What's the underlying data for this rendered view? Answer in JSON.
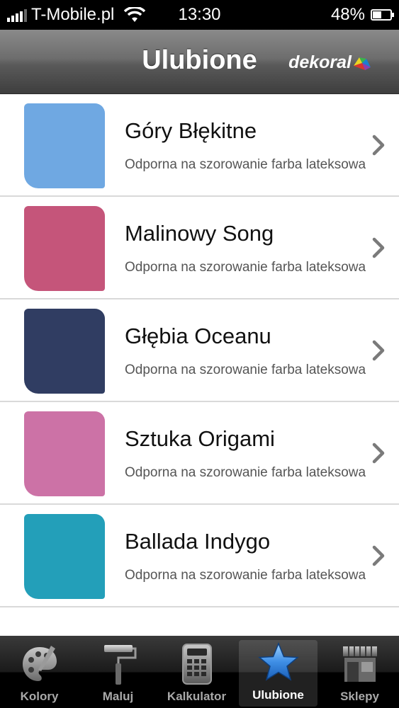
{
  "status_bar": {
    "carrier": "T-Mobile.pl",
    "time": "13:30",
    "battery": "48%",
    "battery_level": 0.48
  },
  "nav": {
    "title": "Ulubione",
    "brand": "dekoral"
  },
  "items": [
    {
      "name": "Góry Błękitne",
      "description": "Odporna na szorowanie farba lateksowa",
      "color": "#6fa8e2"
    },
    {
      "name": "Malinowy Song",
      "description": "Odporna na szorowanie farba lateksowa",
      "color": "#c5557a"
    },
    {
      "name": "Głębia Oceanu",
      "description": "Odporna na szorowanie farba lateksowa",
      "color": "#303d62"
    },
    {
      "name": "Sztuka Origami",
      "description": "Odporna na szorowanie farba lateksowa",
      "color": "#cc72a6"
    },
    {
      "name": "Ballada Indygo",
      "description": "Odporna na szorowanie farba lateksowa",
      "color": "#239fb9"
    }
  ],
  "tabs": [
    {
      "label": "Kolory",
      "icon": "palette-icon",
      "active": false
    },
    {
      "label": "Maluj",
      "icon": "paint-roller-icon",
      "active": false
    },
    {
      "label": "Kalkulator",
      "icon": "calculator-icon",
      "active": false
    },
    {
      "label": "Ulubione",
      "icon": "star-icon",
      "active": true
    },
    {
      "label": "Sklepy",
      "icon": "shop-icon",
      "active": false
    }
  ]
}
